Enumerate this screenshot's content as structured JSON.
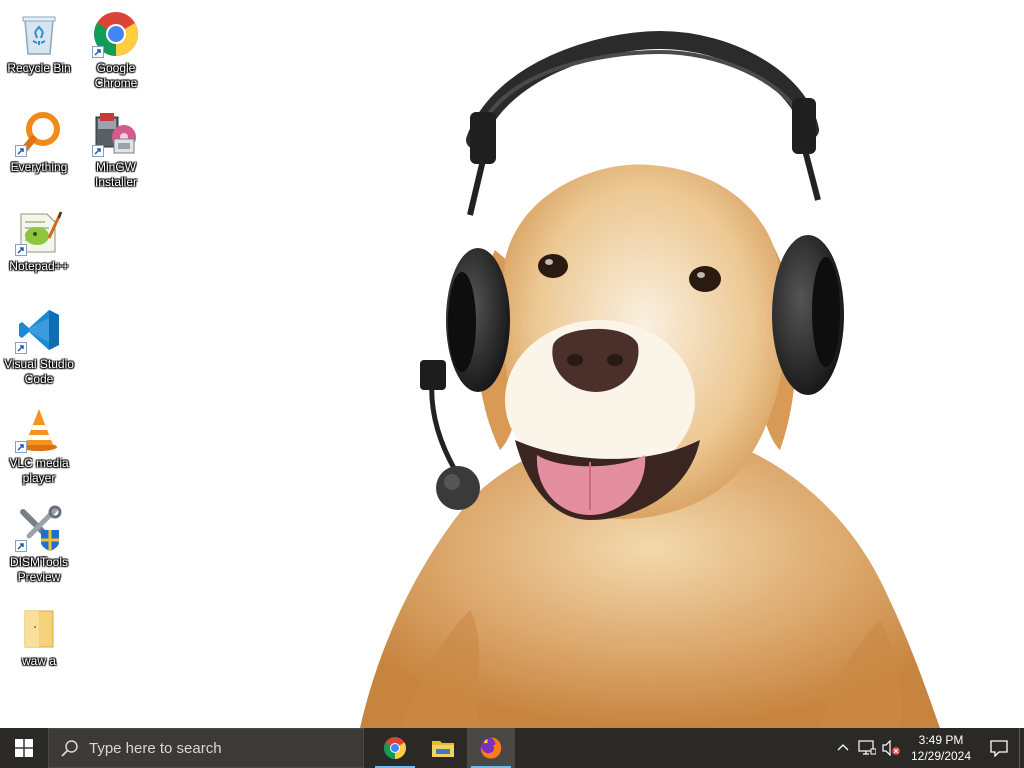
{
  "desktop": {
    "icons": [
      {
        "label": "Recycle Bin",
        "icon": "recycle-bin-icon"
      },
      {
        "label": "Google Chrome",
        "icon": "chrome-icon"
      },
      {
        "label": "Everything",
        "icon": "everything-search-icon"
      },
      {
        "label": "MinGW Installer",
        "icon": "mingw-installer-icon"
      },
      {
        "label": "Notepad++",
        "icon": "notepad-plus-plus-icon"
      },
      {
        "label": "Visual Studio Code",
        "icon": "vscode-icon"
      },
      {
        "label": "VLC media player",
        "icon": "vlc-icon"
      },
      {
        "label": "DISMTools Preview",
        "icon": "dismtools-icon"
      },
      {
        "label": "waw a",
        "icon": "folder-icon"
      }
    ],
    "wallpaper": "golden-retriever-with-headset"
  },
  "taskbar": {
    "search_placeholder": "Type here to search",
    "pinned_apps": [
      {
        "name": "Google Chrome",
        "icon": "chrome-icon",
        "running": true
      },
      {
        "name": "File Explorer",
        "icon": "file-explorer-icon",
        "running": false
      },
      {
        "name": "Firefox",
        "icon": "firefox-icon",
        "running": true,
        "active": true
      }
    ],
    "tray": {
      "icons": [
        "chevron-up-icon",
        "network-icon",
        "volume-muted-icon"
      ]
    },
    "clock": {
      "time": "3:49 PM",
      "date": "12/29/2024"
    }
  },
  "colors": {
    "taskbar_bg": "#2a2926",
    "search_bg": "#3b3a37",
    "running_indicator": "#76b9ed",
    "windows_logo": "#ffffff"
  }
}
